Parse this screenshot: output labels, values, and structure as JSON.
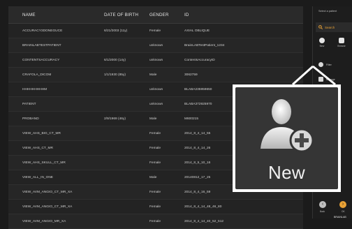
{
  "table": {
    "headers": [
      "NAME",
      "DATE OF BIRTH",
      "GENDER",
      "ID"
    ],
    "rows": [
      [
        "ACCURACY3DONEGUCE",
        "6/21/2003 (11y)",
        "Female",
        "AXIAL OBLIQUE"
      ],
      [
        "BRAINLABTESTPATIENT",
        "",
        "unknown",
        "BrainLABTestPatient_1234"
      ],
      [
        "CONTENTSACCURACY",
        "6/1/2000 (14y)",
        "unknown",
        "ContentsAccuracyID"
      ],
      [
        "CRAFOLA_DICOM",
        "1/1/1930 (85y)",
        "Male",
        "3062759"
      ],
      [
        "HHHHHHHHHM",
        "",
        "unknown",
        "BLABA235959650"
      ],
      [
        "PATIENT",
        "",
        "unknown",
        "BLABA372925970"
      ],
      [
        "PROBAND",
        "2/9/1969 (46y)",
        "Male",
        "M600215"
      ],
      [
        "VIEW_AHS_BIG_CT_MR",
        "",
        "Female",
        "2014_8_4_14_55"
      ],
      [
        "VIEW_AHS_CT_MR",
        "",
        "Female",
        "2014_8_4_14_26"
      ],
      [
        "VIEW_AHS_SKULL_CT_MR",
        "",
        "Female",
        "2014_8_5_10_16"
      ],
      [
        "VIEW_ALL_IN_ONE",
        "",
        "Male",
        "20140812_17_25"
      ],
      [
        "VIEW_AVM_ANGIO_CT_MR_XA",
        "",
        "Female",
        "2014_8_4_16_59"
      ],
      [
        "VIEW_AVM_ANGIO_CT_MR_XA",
        "",
        "Female",
        "2014_8_4_14_48_46_80"
      ],
      [
        "VIEW_AVM_ANGIO_MR_XA",
        "",
        "Female",
        "2014_8_4_14_40_52_512"
      ]
    ]
  },
  "sidebar": {
    "title": "Select a patient",
    "search_label": "Search",
    "new_label": "New",
    "browse_label": "Browse",
    "filter_label": "Filter",
    "manage_label": "Manage",
    "back_label": "Back",
    "next_label": "OK",
    "brand": "BRAINLAB"
  },
  "callout": {
    "label": "New"
  }
}
